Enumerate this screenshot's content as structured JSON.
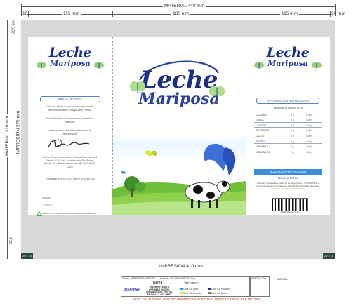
{
  "dimensions": {
    "material_width": "MATERIAL 440 mm",
    "panel_margin_left": "10",
    "panel_left": "115 mm",
    "panel_mid": "180 mm",
    "panel_right": "115 mm",
    "panel_margin_right": "20 mm",
    "material_height": "MATERIAL 320 mm",
    "impresion_height": "IMPRESIÓN 275 mm",
    "top_margin": "22,5 mm",
    "bottom_margin": "22,5",
    "impresion_width": "IMPRESIÓN 410  mm",
    "corner_label": "20 x 10"
  },
  "brand": {
    "line1": "Leche",
    "line2": "Mariposa"
  },
  "left_panel": {
    "precautions_title": "PRECAUCIONES",
    "precautions_text1": "Una vez abierta la bolsa conservarla cerrada herméticamente en un lugar seco y fresco.",
    "precautions_text2": "No introducir en la bolsa cucharas y utensilios húmedos.",
    "registered_text": "Elaborado en la República Bolivariana de Venezuela por:",
    "address_text": "Av. Los Próceres cruce Zona Industrial Res Nueva Nº Galpón Nº Nº Vdo. Zona Industrial San Rafael, Mérida, Edo. Mérida Venezuela. Telfs: (0274) 000-0000",
    "registered_no": "Registrado en el M.S.D.S. bajo el Nº A-000.000",
    "vence_label": "VENCE:",
    "lote_label": "LOTE NO.:",
    "recycle_text": "HECHO EN LA REPÚBLICA BOLIVARIANA DE VENEZUELA"
  },
  "right_panel": {
    "nutrition_title": "INFORMACIÓN NUTRICIONAL",
    "portion_text": "Tamaño de la porción: 100 g",
    "nutrients": [
      {
        "name": "CALORÍAS",
        "value": "0 g",
        "per": "/100 g"
      },
      {
        "name": "GRASA",
        "value": "0 g",
        "per": "/100 g"
      },
      {
        "name": "LACTOSA",
        "value": "0 g",
        "per": "/100 g"
      },
      {
        "name": "PROTEÍNAS",
        "value": "0 g",
        "per": "/100 g"
      },
      {
        "name": "CALCIO",
        "value": "0 g",
        "per": "/100 g"
      },
      {
        "name": "HIERRO",
        "value": "0 g",
        "per": "/100 g"
      },
      {
        "name": "VITAMINA A",
        "value": "0 g",
        "per": "/100 g"
      },
      {
        "name": "VITAMINA D3",
        "value": "0 g",
        "per": "/100 g"
      }
    ],
    "prep_title": "MODO DE PREPARACIÓN",
    "prep_yield": "Rinde 8 Litros",
    "prep_text": "Vierta 16 cucharaditas rasas de leche en Polvo LA MARIPOSA a medio litro de agua previamente hervida. Mezcle hasta disolverse y complete con agua hasta el 1/2 litro.",
    "barcode_number": "7 598765 432100"
  },
  "footer": {
    "client_label": "Cliente: EMPRESAS MARIPOSA",
    "product_label": "Producto: LECHE MARIPOSA 1 kg",
    "nota_title": "NOTA",
    "nota_text": "FAVOR REVISAR Y APROBAR DISEÑO, DISTRIBUCIÓN, TEXTOS, MEDIDAS Y COLORES",
    "company_name": "World Flex",
    "colors_title": "Total Colores: 6",
    "color_1": "Color 01: Cyan",
    "color_2": "Color 02: Amarillo",
    "color_3": "Color 03: Pantone",
    "color_4": "Color 04: Blanco",
    "approval_label": "APROBACIÓN",
    "material_label": "MATERIAL",
    "legal_text": "Nota: Su firma en este documento nos autoriza a reproducir este arte tal cual"
  },
  "colors": {
    "brand_blue": "#1a2f8a",
    "accent_blue": "#3c8ed8",
    "grass_green": "#6fbf3a",
    "legal_red": "#c0392b"
  }
}
